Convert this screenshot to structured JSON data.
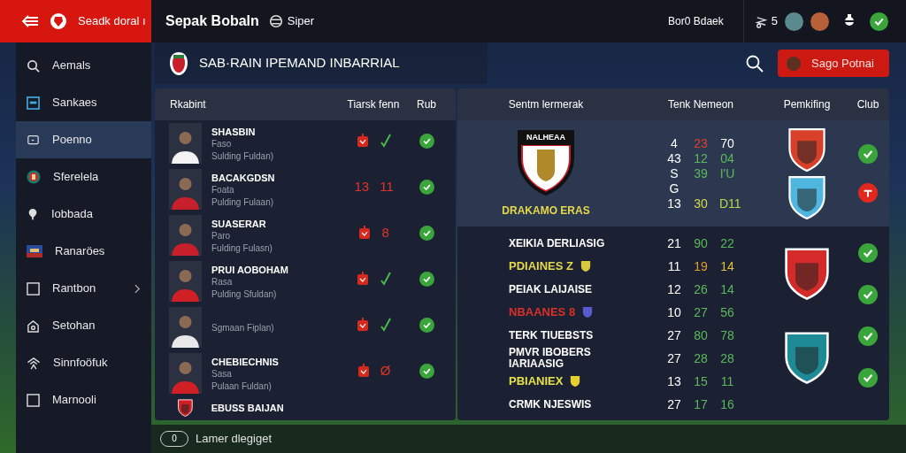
{
  "top_bar": {
    "app_title": "Seadk doral ı",
    "title": "Sepak Bobaln",
    "subtitle": "Siper",
    "account": "Bor0 Bdaek",
    "count": "5",
    "status_ok": true
  },
  "sidebar": {
    "items": [
      {
        "kind": "search",
        "label": "Aemals",
        "selected": false
      },
      {
        "kind": "panel",
        "label": "Sankaes",
        "selected": false
      },
      {
        "kind": "monitor",
        "label": "Poenno",
        "selected": true
      },
      {
        "kind": "crest",
        "label": "Sferelela",
        "selected": false
      },
      {
        "kind": "pin",
        "label": "Iobbada",
        "selected": false
      },
      {
        "kind": "flag",
        "label": "Ranaröes",
        "selected": false
      },
      {
        "kind": "square",
        "label": "Rantbon",
        "selected": false,
        "has_submenu": true
      },
      {
        "kind": "home",
        "label": "Setohan",
        "selected": false
      },
      {
        "kind": "network",
        "label": "Sinnfoöfuk",
        "selected": false
      },
      {
        "kind": "square",
        "label": "Marnooli",
        "selected": false
      }
    ]
  },
  "header": {
    "title": "SAB·RAIN IPEMAND INBARRIAL",
    "button": "Sago Potnai"
  },
  "players": {
    "columns": [
      "Rkabint",
      "Tiarsk fenn",
      "Rub"
    ],
    "rows": [
      {
        "kind": "player",
        "color": "#f3f3f3",
        "name": "SHASBIN",
        "line_1": "Faso",
        "line_2": "Sulding Fuldan)",
        "marks": [
          {
            "kind": "card"
          },
          {
            "kind": "tick"
          }
        ],
        "verified": true
      },
      {
        "kind": "player",
        "color": "#c8202a",
        "name": "BACAKGDSN",
        "line_1": "Foata",
        "line_2": "Pulding Fulaan)",
        "marks": [
          {
            "kind": "number",
            "text": "13"
          },
          {
            "kind": "number",
            "text": "11"
          }
        ],
        "verified": true
      },
      {
        "kind": "player",
        "color": "#c8202a",
        "name": "SUASERAR",
        "line_1": "Paro",
        "line_2": "Fulding Fulasn)",
        "marks": [
          {
            "kind": "card"
          },
          {
            "kind": "number",
            "text": "8"
          }
        ],
        "verified": true
      },
      {
        "kind": "player",
        "color": "#d11f26",
        "name": "PRUI AOBOHAM",
        "line_1": "Rasa",
        "line_2": "Pulding Sfuldan)",
        "marks": [
          {
            "kind": "card"
          },
          {
            "kind": "tick"
          }
        ],
        "verified": true
      },
      {
        "kind": "player",
        "color": "#e8e8e8",
        "line_2": "Sgmaan Fiplan)",
        "marks": [
          {
            "kind": "card"
          },
          {
            "kind": "tick"
          }
        ],
        "verified": true
      },
      {
        "kind": "player",
        "color": "#d11f26",
        "name": "CHEBIECHNIS",
        "line_1": "Sasa",
        "line_2": "Pulaan Fuldan)",
        "marks": [
          {
            "kind": "card"
          },
          {
            "kind": "number",
            "text": "Ø"
          }
        ],
        "verified": true
      },
      {
        "kind": "club",
        "color": "#d11f26",
        "name": "EBUSS BAIJAN",
        "marks": []
      }
    ]
  },
  "standings": {
    "columns": [
      "Sentm lermerak",
      "Tenk Nemeon",
      "Pemkifing",
      "Club"
    ],
    "featured": {
      "selected": true,
      "name": "DRAKAMO ERAS",
      "color": "#e6d84a",
      "crest_text": "NALHEAA",
      "numbers": [
        [
          {
            "text": "4",
            "color": "#ffffff"
          },
          {
            "text": "23",
            "color": "#e0402a"
          },
          {
            "text": "70",
            "color": "#ffffff"
          }
        ],
        [
          {
            "text": "43",
            "color": "#ffffff"
          },
          {
            "text": "12",
            "color": "#5cb85c"
          },
          {
            "text": "04",
            "color": "#5cb85c"
          }
        ],
        [
          {
            "text": "S",
            "color": "#ffffff"
          },
          {
            "text": "39",
            "color": "#5cb85c"
          },
          {
            "text": "I'U",
            "color": "#5cb85c"
          }
        ],
        [
          {
            "text": "G",
            "color": "#ffffff"
          }
        ],
        [
          {
            "text": "13",
            "color": "#ffffff"
          },
          {
            "text": "30",
            "color": "#d8d84a"
          },
          {
            "text": "D11",
            "color": "#b8d84a"
          }
        ]
      ],
      "clubs": [
        {
          "color": "#d9402a"
        },
        {
          "color": "#4fb6e0"
        }
      ],
      "statuses": [
        {
          "verified": true
        },
        {
          "verified": false
        }
      ]
    },
    "lines": [
      {
        "name": "XEIKIA DERLIASIG",
        "color": "#ffffff",
        "numbers": [
          {
            "text": "21",
            "color": "#ffffff"
          },
          {
            "text": "90",
            "color": "#5cb85c"
          },
          {
            "text": "22",
            "color": "#5cb85c"
          }
        ]
      },
      {
        "name": "PDIAINES Z",
        "color": "#e6d84a",
        "shield": {
          "color": "#d8c83a"
        },
        "numbers": [
          {
            "text": "11",
            "color": "#ffffff"
          },
          {
            "text": "19",
            "color": "#e0a030"
          },
          {
            "text": "14",
            "color": "#e0c030"
          }
        ]
      },
      {
        "name": "PEIAK LAIJAISE",
        "color": "#ffffff",
        "numbers": [
          {
            "text": "12",
            "color": "#ffffff"
          },
          {
            "text": "26",
            "color": "#5cb85c"
          },
          {
            "text": "14",
            "color": "#5cb85c"
          }
        ]
      },
      {
        "name": "NBAANES 8",
        "color": "#d8302a",
        "shield": {
          "color": "#5a5ad0"
        },
        "numbers": [
          {
            "text": "10",
            "color": "#ffffff"
          },
          {
            "text": "27",
            "color": "#5cb85c"
          },
          {
            "text": "56",
            "color": "#5cb85c"
          }
        ]
      },
      {
        "name": "TERK TIUEBSTS",
        "color": "#ffffff",
        "numbers": [
          {
            "text": "27",
            "color": "#ffffff"
          },
          {
            "text": "80",
            "color": "#5cb85c"
          },
          {
            "text": "78",
            "color": "#5cb85c"
          }
        ]
      },
      {
        "name": "PMVR IBOBERS IARIAASIG",
        "color": "#ffffff",
        "numbers": [
          {
            "text": "27",
            "color": "#ffffff"
          },
          {
            "text": "28",
            "color": "#5cb85c"
          },
          {
            "text": "28",
            "color": "#5cb85c"
          }
        ]
      },
      {
        "name": "PBIANIEX",
        "color": "#e6e04a",
        "shield": {
          "color": "#e6d030"
        },
        "numbers": [
          {
            "text": "13",
            "color": "#ffffff"
          },
          {
            "text": "15",
            "color": "#5cb85c"
          },
          {
            "text": "11",
            "color": "#5cb85c"
          }
        ]
      },
      {
        "name": "CRMK NJESWIS",
        "color": "#ffffff",
        "numbers": [
          {
            "text": "27",
            "color": "#ffffff"
          },
          {
            "text": "17",
            "color": "#5cb85c"
          },
          {
            "text": "16",
            "color": "#5cb85c"
          }
        ]
      }
    ],
    "clubs": [
      {
        "color": "#d42a2a"
      },
      {
        "color": "#1e8a96"
      }
    ],
    "statuses": [
      {
        "verified": true
      },
      {
        "verified": true
      },
      {
        "verified": true
      },
      {
        "verified": true
      }
    ]
  },
  "bottom_bar": {
    "button": "0",
    "label": "Lamer dlegiget"
  }
}
